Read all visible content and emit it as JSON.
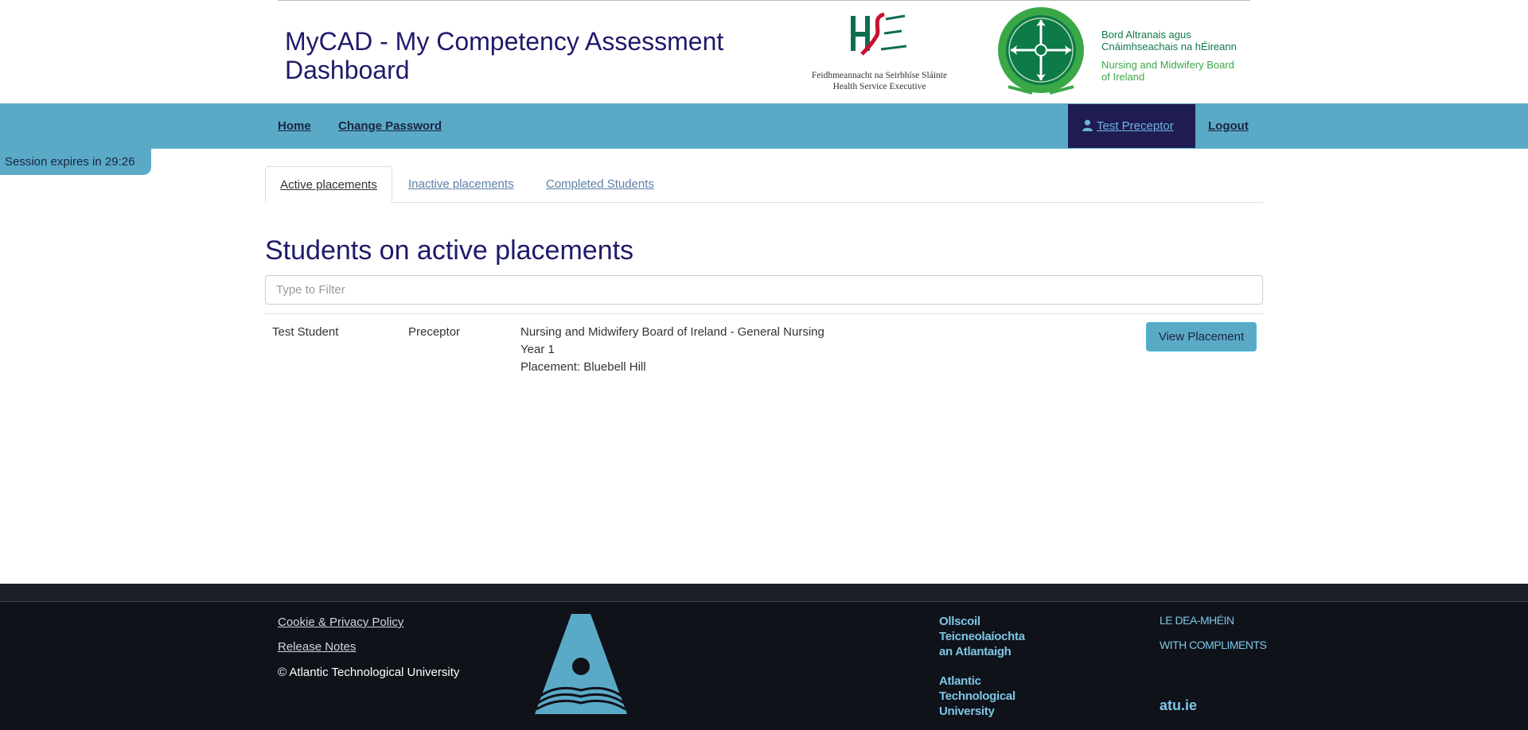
{
  "header": {
    "title": "MyCAD - My Competency Assessment Dashboard",
    "hse_caption_line1": "Feidhmeannacht na Seirbhíse Sláinte",
    "hse_caption_line2": "Health Service Executive",
    "nmbi_irish_line1": "Bord Altranais agus",
    "nmbi_irish_line2": "Cnáimhseachais na hÉireann",
    "nmbi_english_line1": "Nursing and Midwifery Board",
    "nmbi_english_line2": "of Ireland"
  },
  "nav": {
    "home": "Home",
    "change_password": "Change Password",
    "user": "Test Preceptor",
    "logout": "Logout",
    "user_icon": "user-icon"
  },
  "session": {
    "text": "Session expires in 29:26"
  },
  "tabs": [
    {
      "label": "Active placements",
      "active": true
    },
    {
      "label": "Inactive placements",
      "active": false
    },
    {
      "label": "Completed Students",
      "active": false
    }
  ],
  "main": {
    "heading": "Students on active placements",
    "filter_placeholder": "Type to Filter",
    "rows": [
      {
        "student": "Test Student",
        "role": "Preceptor",
        "programme": "Nursing and Midwifery Board of Ireland - General Nursing",
        "year": "Year 1",
        "placement": "Placement: Bluebell Hill",
        "action": "View Placement"
      }
    ]
  },
  "footer": {
    "cookie": "Cookie & Privacy Policy",
    "release_notes": "Release Notes",
    "copyright": "© Atlantic Technological University",
    "atu_irish_line1": "Ollscoil",
    "atu_irish_line2": "Teicneolaíochta",
    "atu_irish_line3": "an Atlantaigh",
    "atu_en_line1": "Atlantic",
    "atu_en_line2": "Technological",
    "atu_en_line3": "University",
    "compliments_irish": "LE DEA-MHÉIN",
    "compliments_en": "WITH COMPLIMENTS",
    "url": "atu.ie"
  },
  "colors": {
    "navbar": "#5aaac7",
    "title": "#1f1a6b",
    "user_bg": "#1f1c52",
    "footer_bg": "#0f1219",
    "atu_accent": "#7ec6e6"
  }
}
